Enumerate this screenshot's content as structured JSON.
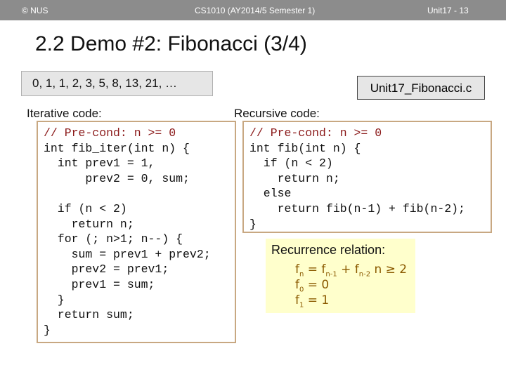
{
  "header": {
    "copyright": "© NUS",
    "course": "CS1010 (AY2014/5 Semester 1)",
    "slide_no": "Unit17 - 13"
  },
  "title": "2.2 Demo #2: Fibonacci (3/4)",
  "sequence": "0, 1, 1, 2, 3, 5, 8, 13, 21, …",
  "filename": "Unit17_Fibonacci.c",
  "iterative": {
    "label": "Iterative code:",
    "lines": [
      "// Pre-cond: n >= 0",
      "int fib_iter(int n) {",
      "  int prev1 = 1,",
      "      prev2 = 0, sum;",
      "",
      "  if (n < 2)",
      "    return n;",
      "  for (; n>1; n--) {",
      "    sum = prev1 + prev2;",
      "    prev2 = prev1;",
      "    prev1 = sum;",
      "  }",
      "  return sum;",
      "}"
    ]
  },
  "recursive": {
    "label": "Recursive code:",
    "lines": [
      "// Pre-cond: n >= 0",
      "int fib(int n) {",
      "  if (n < 2)",
      "    return n;",
      "  else",
      "    return fib(n-1) + fib(n-2);",
      "}"
    ]
  },
  "recurrence": {
    "title": "Recurrence relation:",
    "eq1_main": "f",
    "eq1_sub_n": "n",
    "eq1_eq": " = f",
    "eq1_sub_a": "n-1",
    "eq1_plus": " + f",
    "eq1_sub_b": "n-2",
    "eq1_cond": "  n ≥ 2",
    "eq2_main": "f",
    "eq2_sub": "0",
    "eq2_rest": " = 0",
    "eq3_main": "f",
    "eq3_sub": "1",
    "eq3_rest": " = 1"
  }
}
